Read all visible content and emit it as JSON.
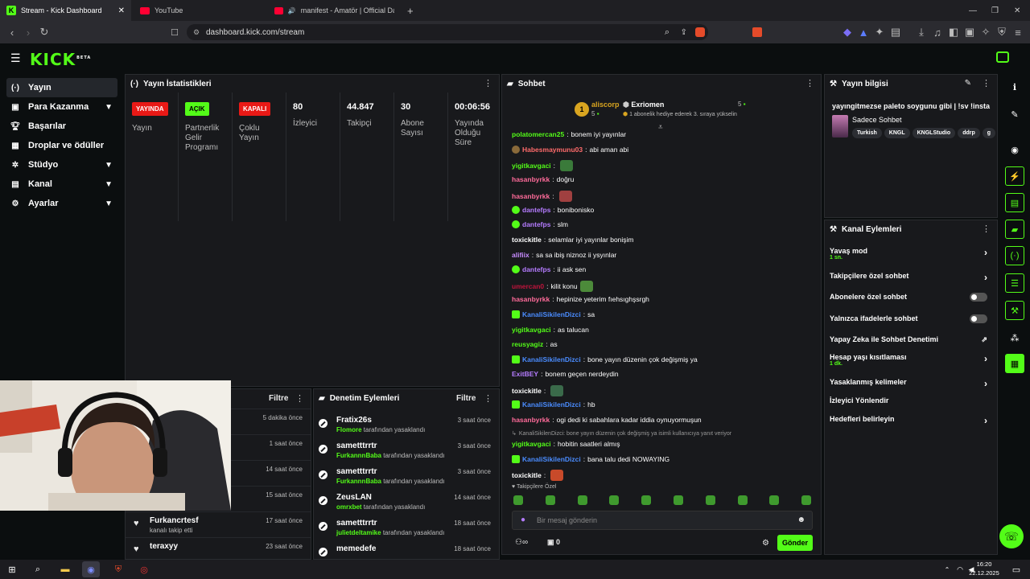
{
  "browser": {
    "tabs": [
      {
        "title": "Stream - Kick Dashboard"
      },
      {
        "title": "YouTube"
      },
      {
        "title": "manifest - Amatör | Official Danc"
      }
    ],
    "url": "dashboard.kick.com/stream",
    "plus": "+"
  },
  "brand": {
    "logo": "KICK",
    "beta": "BETA",
    "accent": "#53fc18"
  },
  "sidebar": {
    "items": [
      {
        "label": "Yayın",
        "icon": "broadcast-icon"
      },
      {
        "label": "Para Kazanma",
        "icon": "wallet-icon"
      },
      {
        "label": "Başarılar",
        "icon": "trophy-icon"
      },
      {
        "label": "Droplar ve ödüller",
        "icon": "gift-icon"
      },
      {
        "label": "Stüdyo",
        "icon": "settings-icon"
      },
      {
        "label": "Kanal",
        "icon": "channel-icon"
      },
      {
        "label": "Ayarlar",
        "icon": "gear-icon"
      }
    ]
  },
  "stats": {
    "title": "Yayın İstatistikleri",
    "cols": [
      {
        "badge": "YAYINDA",
        "label": "Yayın",
        "color": "#e91916"
      },
      {
        "badge": "AÇIK",
        "label": "Partnerlik Gelir Programı",
        "color": "#53fc18"
      },
      {
        "badge": "KAPALI",
        "label": "Çoklu Yayın",
        "color": "#e91916"
      },
      {
        "value": "80",
        "label": "İzleyici"
      },
      {
        "value": "44.847",
        "label": "Takipçi"
      },
      {
        "value": "30",
        "label": "Abone Sayısı"
      },
      {
        "value": "00:06:56",
        "label": "Yayında Olduğu Süre"
      }
    ]
  },
  "activity": {
    "filter": "Filtre",
    "rows": [
      {
        "time": "5 dakika önce"
      },
      {
        "time": "1 saat önce"
      },
      {
        "time": "14 saat önce"
      },
      {
        "time": "15 saat önce"
      },
      {
        "name": "Furkancrtesf",
        "sub": "kanalı takip etti",
        "time": "17 saat önce"
      },
      {
        "name": "teraxyy",
        "time": "23 saat önce"
      }
    ]
  },
  "mod": {
    "title": "Denetim Eylemleri",
    "filter": "Filtre",
    "by": "tarafından yasaklandı",
    "rows": [
      {
        "name": "Fratix26s",
        "mod": "Flomore",
        "time": "3 saat önce"
      },
      {
        "name": "sametttrrtr",
        "mod": "FurkannnBaba",
        "time": "3 saat önce"
      },
      {
        "name": "sametttrrtr",
        "mod": "FurkannnBaba",
        "time": "3 saat önce"
      },
      {
        "name": "ZeusLAN",
        "mod": "omrxbet",
        "time": "14 saat önce"
      },
      {
        "name": "sametttrrtr",
        "mod": "julietdeltamike",
        "time": "18 saat önce"
      },
      {
        "name": "memedefe",
        "time": "18 saat önce"
      }
    ]
  },
  "chat": {
    "title": "Sohbet",
    "leader": {
      "rank": "1",
      "name": "aliscorp",
      "count": "5"
    },
    "gifter": {
      "name": "Exriomen",
      "count": "5",
      "note": "1 abonelik hediye ederek 3. sıraya yükselin"
    },
    "messages": [
      {
        "user": "polatomercan25",
        "text": "bonem iyi yayınlar",
        "color": "#53fc18"
      },
      {
        "user": "Habesmaymunu03",
        "text": "abi aman abi",
        "color": "#ff6b6b",
        "badge": "brown"
      },
      {
        "user": "yigitkavgaci",
        "text": "",
        "color": "#53fc18",
        "emote": "#3a7a3a"
      },
      {
        "user": "hasanbyrkk",
        "text": "doğru",
        "color": "#ff6b9a"
      },
      {
        "user": "hasanbyrkk",
        "text": "",
        "color": "#ff6b9a",
        "emote": "#a04040"
      },
      {
        "user": "dantefps",
        "text": "bonibonisko",
        "color": "#b57cff",
        "badge": "verified"
      },
      {
        "user": "dantefps",
        "text": "slm",
        "color": "#b57cff",
        "badge": "verified"
      },
      {
        "user": "toxickitle",
        "text": "selamlar iyi yayınlar bonişim",
        "color": "#ffffff"
      },
      {
        "user": "alifiix",
        "text": "sa sa ibiş niznoz ii ysyınlar",
        "color": "#c78cff"
      },
      {
        "user": "dantefps",
        "text": "ii ask sen",
        "color": "#b57cff",
        "badge": "verified"
      },
      {
        "user": "umercan0",
        "text": "kilit konu",
        "color": "#c0143c",
        "emote": "#4c8a3a"
      },
      {
        "user": "hasanbyrkk",
        "text": "hepinize yeterim fıehsıghşsrgh",
        "color": "#ff6b9a"
      },
      {
        "user": "KanaliSikilenDizci",
        "text": "sa",
        "color": "#4a8cff",
        "badge": "sub"
      },
      {
        "user": "yigitkavgaci",
        "text": "as talucan",
        "color": "#53fc18"
      },
      {
        "user": "reusyagiz",
        "text": "as",
        "color": "#53fc18"
      },
      {
        "user": "KanaliSikilenDizci",
        "text": "bone yayın düzenin çok değişmiş ya",
        "color": "#4a8cff",
        "badge": "sub"
      },
      {
        "user": "ExitBEY",
        "text": "bonem geçen nerdeydin",
        "color": "#b57cff"
      },
      {
        "user": "toxickitle",
        "text": "",
        "color": "#ffffff",
        "emote": "#3a6a4a"
      },
      {
        "user": "KanaliSikilenDizci",
        "text": "hb",
        "color": "#4a8cff",
        "badge": "sub"
      },
      {
        "user": "hasanbyrkk",
        "text": "ogi dedi ki sabahlara kadar iddia oynuyormuşun",
        "color": "#ff6b9a"
      },
      {
        "reply": "KanaliSikilenDizci: bone yayın düzenin çok değişmiş ya isimli kullanıcıya yanıt veriyor"
      },
      {
        "user": "yigitkavgaci",
        "text": "hobitin saatleri almış",
        "color": "#53fc18"
      },
      {
        "user": "KanaliSikilenDizci",
        "text": "bana talu dedi NOWAYING",
        "color": "#4a8cff",
        "badge": "sub"
      },
      {
        "user": "toxickitle",
        "text": "",
        "color": "#ffffff",
        "emote": "#c84a2a"
      }
    ],
    "followers_only": "Takipçilere Özel",
    "placeholder": "Bir mesaj gönderin",
    "points": "0",
    "send": "Gönder"
  },
  "info": {
    "title": "Yayın bilgisi",
    "stream_title": "yayıngitmezse paleto soygunu gibi | !sv !insta",
    "category": "Sadece Sohbet",
    "tags": [
      "Turkish",
      "KNGL",
      "KNGLStudio",
      "ddrp",
      "g"
    ]
  },
  "actions": {
    "title": "Kanal Eylemleri",
    "rows": [
      {
        "label": "Yavaş mod",
        "sub": "1 sn.",
        "control": "arrow"
      },
      {
        "label": "Takipçilere özel sohbet",
        "control": "arrow"
      },
      {
        "label": "Abonelere özel sohbet",
        "control": "toggle"
      },
      {
        "label": "Yalnızca ifadelerle sohbet",
        "control": "toggle"
      },
      {
        "label": "Yapay Zeka ile Sohbet Denetimi",
        "control": "external"
      },
      {
        "label": "Hesap yaşı kısıtlaması",
        "sub": "1 dk.",
        "control": "arrow"
      },
      {
        "label": "Yasaklanmış kelimeler",
        "control": "arrow"
      },
      {
        "label": "İzleyici Yönlendir",
        "control": "none"
      },
      {
        "label": "Hedefleri belirleyin",
        "control": "arrow"
      }
    ]
  },
  "taskbar": {
    "time": "16:20",
    "date": "22.12.2025"
  }
}
